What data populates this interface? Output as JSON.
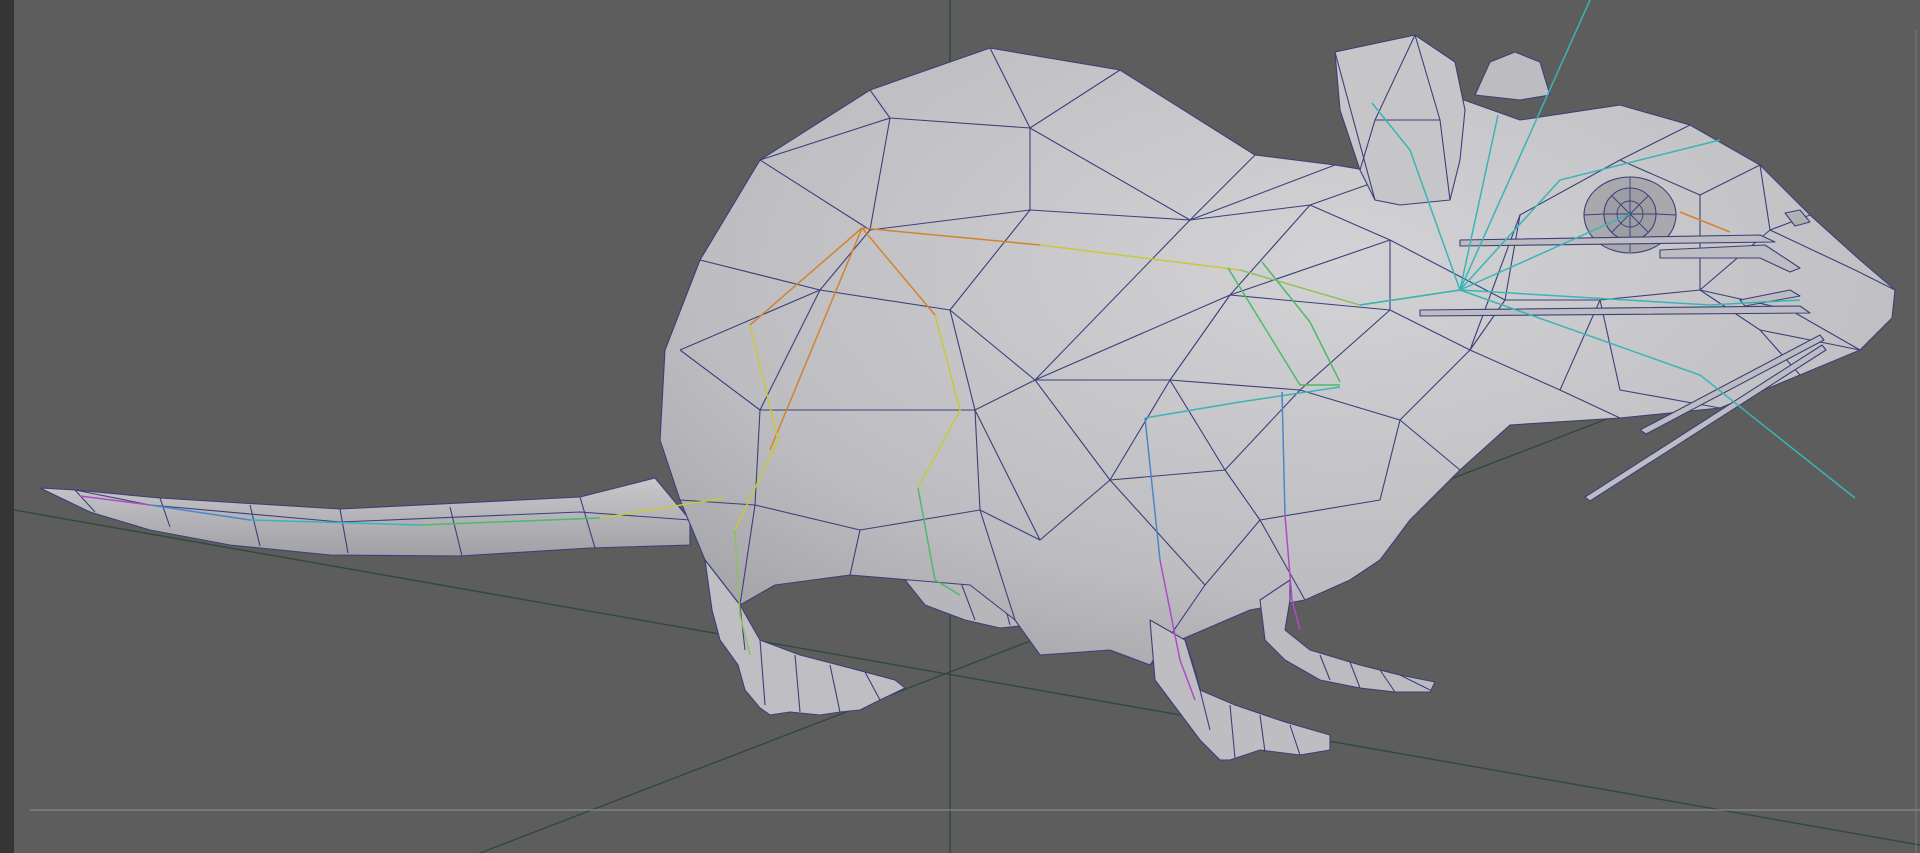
{
  "viewport": {
    "background": "#5d5d5d",
    "panel_strip_color": "#353535",
    "grid_line_color": "#2f4a3c",
    "scene_object": "mouse-model",
    "display_mode": "shaded-with-wireframe",
    "skeleton_visible": true
  },
  "colors": {
    "mesh_fill": "#c2c2c4",
    "mesh_shadow": "#9e9ea2",
    "wireframe": "#3c3f7a",
    "bone_orange": "#d2832d",
    "bone_yellow": "#c8c83c",
    "bone_green": "#4fb86a",
    "bone_cyan": "#39b5b5",
    "bone_blue": "#4a86c8",
    "bone_magenta": "#b04ac8"
  }
}
